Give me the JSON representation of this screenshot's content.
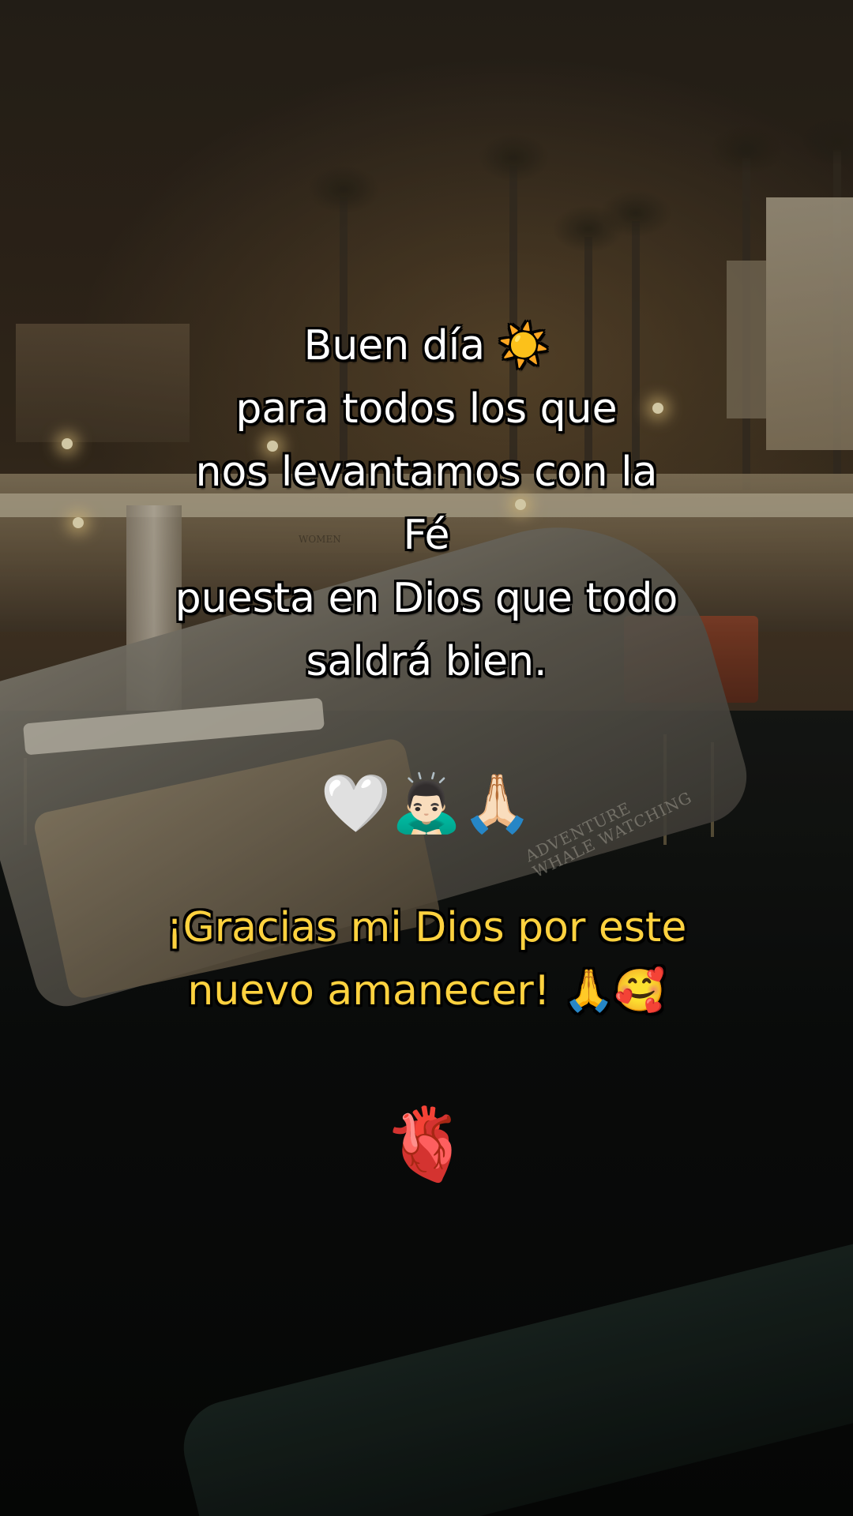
{
  "caption": {
    "intro_lines": [
      "Buen día ☀️",
      "para todos los que",
      "nos levantamos con la",
      "Fé",
      "puesta en Dios que todo",
      "saldrá bien."
    ],
    "emoji_row": "🤍🙇🏻‍♂️🙏🏻",
    "gratitude_lines": [
      "¡Gracias mi Dios por este",
      "nuevo amanecer! 🙏🥰"
    ],
    "closing_emoji": "🫀",
    "gratitude_color": "#ffd23f",
    "text_color": "#ffffff"
  },
  "background": {
    "sign_text": "WOMEN",
    "boat_name_lines": [
      "ADVENTURE",
      "WHALE WATCHING"
    ]
  }
}
